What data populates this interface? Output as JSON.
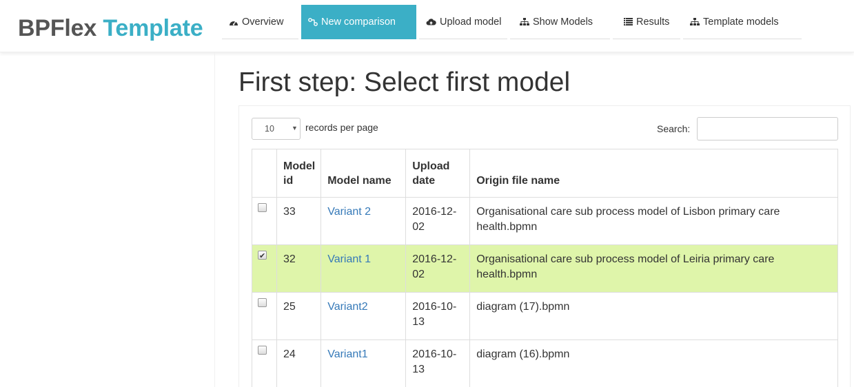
{
  "brand": {
    "part1": "BPFlex",
    "part2": "Template"
  },
  "nav": [
    {
      "label": "Overview",
      "icon": "dashboard-icon",
      "active": false
    },
    {
      "label": "New comparison",
      "icon": "compare-icon",
      "active": true
    },
    {
      "label": "Upload model",
      "icon": "cloud-upload-icon",
      "active": false
    },
    {
      "label": "Show Models",
      "icon": "sitemap-icon",
      "active": false
    },
    {
      "label": "Results",
      "icon": "list-icon",
      "active": false
    },
    {
      "label": "Template models",
      "icon": "sitemap-icon",
      "active": false
    }
  ],
  "page": {
    "title": "First step: Select first model"
  },
  "controls": {
    "page_size": "10",
    "records_label": "records per page",
    "search_label": "Search:",
    "search_value": ""
  },
  "table": {
    "columns": [
      "",
      "Model id",
      "Model name",
      "Upload date",
      "Origin file name"
    ],
    "rows": [
      {
        "checked": false,
        "id": "33",
        "name": "Variant 2",
        "date": "2016-12-02",
        "file": "Organisational care sub process model of Lisbon primary care health.bpmn"
      },
      {
        "checked": true,
        "id": "32",
        "name": "Variant 1",
        "date": "2016-12-02",
        "file": "Organisational care sub process model of Leiria primary care health.bpmn"
      },
      {
        "checked": false,
        "id": "25",
        "name": "Variant2",
        "date": "2016-10-13",
        "file": "diagram (17).bpmn"
      },
      {
        "checked": false,
        "id": "24",
        "name": "Variant1",
        "date": "2016-10-13",
        "file": "diagram (16).bpmn"
      }
    ]
  },
  "colors": {
    "accent": "#3bafc6",
    "selected_row": "#dff5aa",
    "link": "#3579b8"
  }
}
